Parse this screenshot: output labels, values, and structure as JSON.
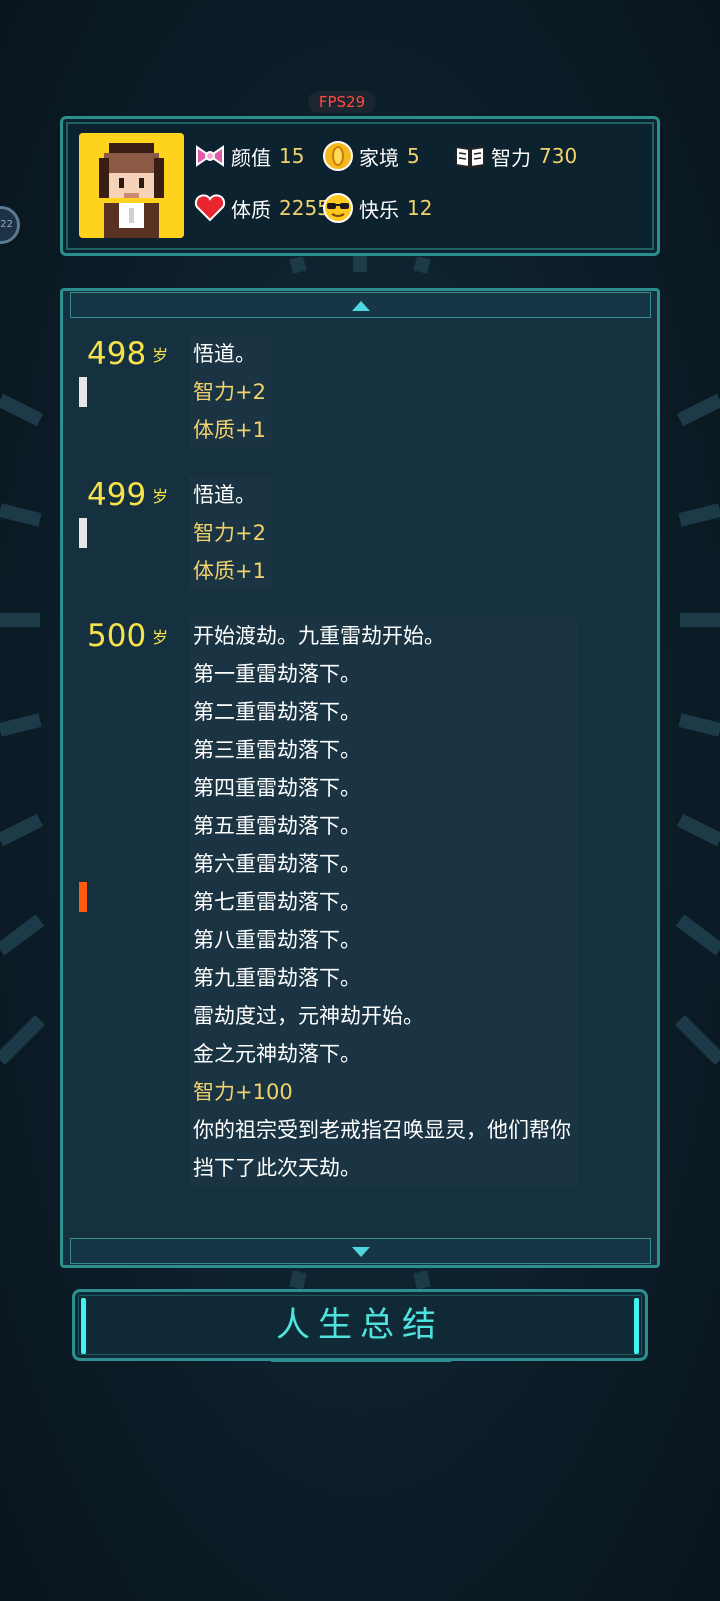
{
  "fps": "FPS29",
  "side_badge": "22",
  "stats": [
    {
      "icon": "bow-icon",
      "label": "颜值",
      "value": "15"
    },
    {
      "icon": "coin-icon",
      "label": "家境",
      "value": "5"
    },
    {
      "icon": "book-icon",
      "label": "智力",
      "value": "730"
    },
    {
      "icon": "heart-icon",
      "label": "体质",
      "value": "2255"
    },
    {
      "icon": "sunglasses-face-icon",
      "label": "快乐",
      "value": "12"
    }
  ],
  "log": [
    {
      "age": "498",
      "unit": "岁",
      "lines": [
        {
          "text": "悟道。",
          "kind": "event"
        },
        {
          "text": "智力+2",
          "kind": "attr"
        },
        {
          "text": "体质+1",
          "kind": "attr"
        }
      ]
    },
    {
      "age": "499",
      "unit": "岁",
      "lines": [
        {
          "text": "悟道。",
          "kind": "event"
        },
        {
          "text": "智力+2",
          "kind": "attr"
        },
        {
          "text": "体质+1",
          "kind": "attr"
        }
      ]
    },
    {
      "age": "500",
      "unit": "岁",
      "lines": [
        {
          "text": "开始渡劫。九重雷劫开始。",
          "kind": "event"
        },
        {
          "text": "第一重雷劫落下。",
          "kind": "event"
        },
        {
          "text": "第二重雷劫落下。",
          "kind": "event"
        },
        {
          "text": "第三重雷劫落下。",
          "kind": "event"
        },
        {
          "text": "第四重雷劫落下。",
          "kind": "event"
        },
        {
          "text": "第五重雷劫落下。",
          "kind": "event"
        },
        {
          "text": "第六重雷劫落下。",
          "kind": "event"
        },
        {
          "text": "第七重雷劫落下。",
          "kind": "event"
        },
        {
          "text": "第八重雷劫落下。",
          "kind": "event"
        },
        {
          "text": "第九重雷劫落下。",
          "kind": "event"
        },
        {
          "text": "雷劫度过，元神劫开始。",
          "kind": "event"
        },
        {
          "text": "金之元神劫落下。",
          "kind": "event"
        },
        {
          "text": "智力+100",
          "kind": "attr"
        },
        {
          "text": "你的祖宗受到老戒指召唤显灵，他们帮你",
          "kind": "event"
        },
        {
          "text": "挡下了此次天劫。",
          "kind": "event"
        }
      ]
    }
  ],
  "summary_button": "人生总结",
  "colors": {
    "age": "#f6e24a",
    "attr": "#f2d36b",
    "accent": "#4fe3df",
    "marker_normal": "#e6e6e6",
    "marker_alert": "#ff5a10"
  }
}
